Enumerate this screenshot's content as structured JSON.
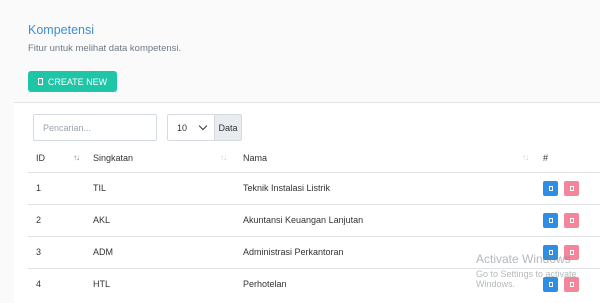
{
  "header": {
    "title": "Kompetensi",
    "subtitle": "Fitur untuk melihat data kompetensi."
  },
  "toolbar": {
    "create_label": "CREATE NEW"
  },
  "filters": {
    "search_placeholder": "Pencarian...",
    "page_length": "10",
    "page_length_addon": "Data"
  },
  "table": {
    "columns": {
      "id": "ID",
      "singkatan": "Singkatan",
      "nama": "Nama",
      "actions": "#"
    },
    "rows": [
      {
        "id": "1",
        "singkatan": "TIL",
        "nama": "Teknik Instalasi Listrik"
      },
      {
        "id": "2",
        "singkatan": "AKL",
        "nama": "Akuntansi Keuangan Lanjutan"
      },
      {
        "id": "3",
        "singkatan": "ADM",
        "nama": "Administrasi Perkantoran"
      },
      {
        "id": "4",
        "singkatan": "HTL",
        "nama": "Perhotelan"
      }
    ]
  },
  "icons": {
    "create": "add-icon",
    "edit": "edit-icon",
    "delete": "trash-icon",
    "sort": "sort-icon"
  },
  "watermark": {
    "line1": "Activate Windows",
    "line2": "Go to Settings to activate Windows."
  },
  "colors": {
    "title": "#3d8fd6",
    "create_button": "#1fc5a7",
    "edit_button": "#2d8fe3",
    "delete_button": "#f3869a"
  }
}
